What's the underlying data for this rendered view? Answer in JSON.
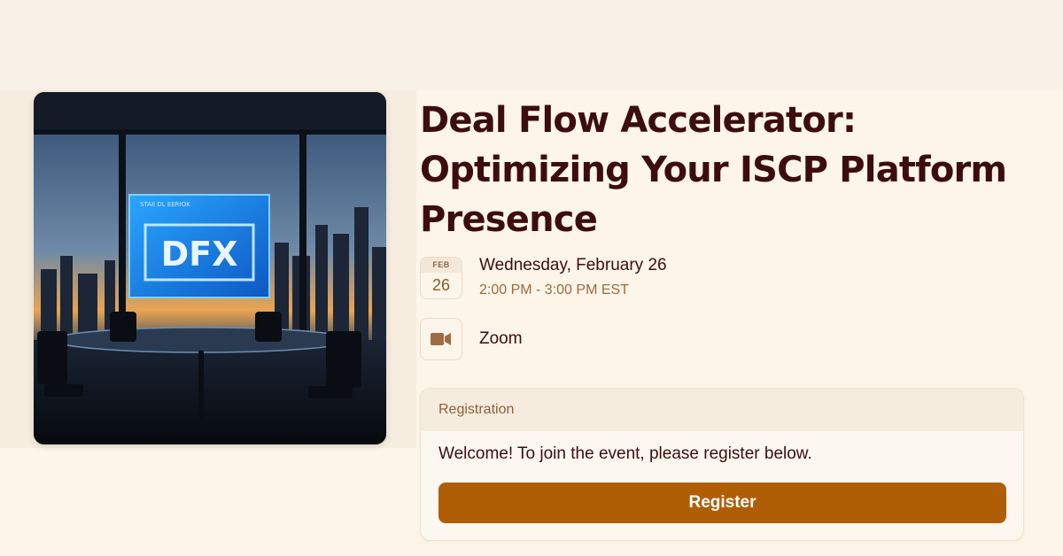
{
  "event": {
    "title": "Deal Flow Accelerator: Optimizing Your ISCP Platform Presence",
    "cover_image": {
      "screen_caption": "STAII DL EERIOK",
      "logo_text": "DFX"
    }
  },
  "date": {
    "month": "FEB",
    "day": "26",
    "weekday_date": "Wednesday, February 26",
    "time_range": "2:00 PM - 3:00 PM EST"
  },
  "location": {
    "icon": "video-camera-icon",
    "label": "Zoom"
  },
  "registration": {
    "header": "Registration",
    "message": "Welcome! To join the event, please register below.",
    "button_label": "Register"
  },
  "colors": {
    "page_background": "#fcf5e8",
    "title_text": "#3d0d0d",
    "muted_text": "#9c6a3e",
    "register_button": "#b05e06"
  }
}
